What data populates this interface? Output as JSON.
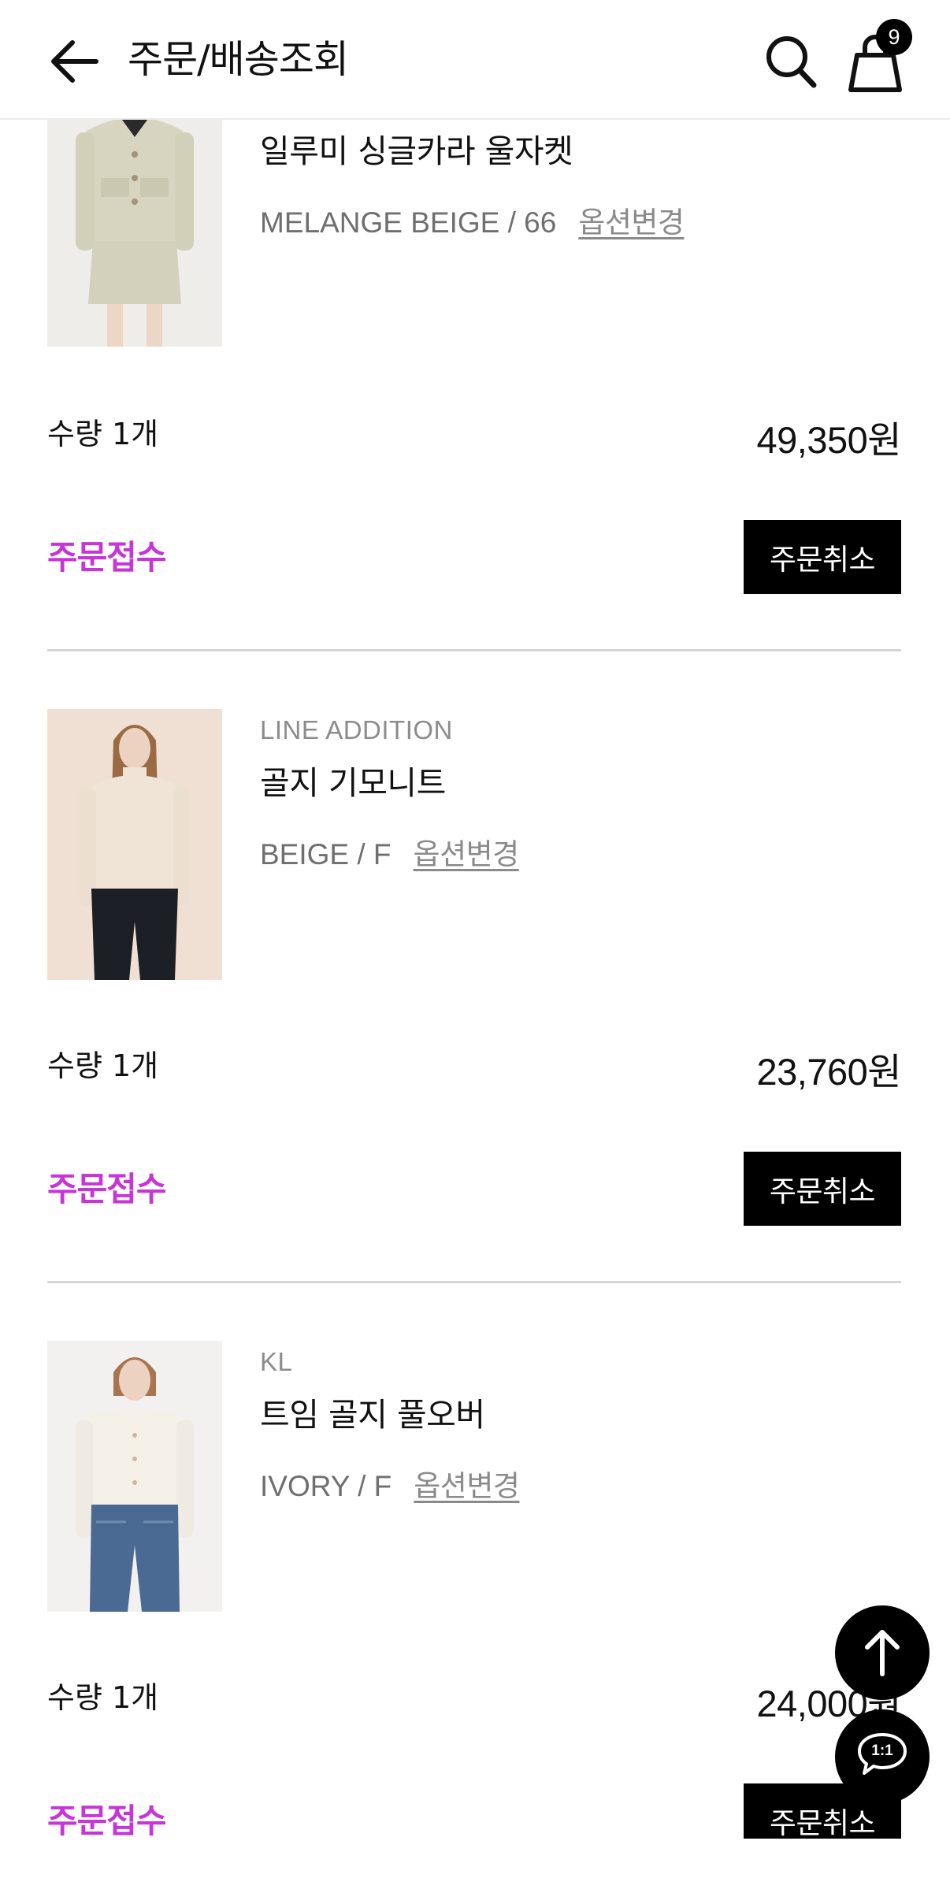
{
  "header": {
    "title": "주문/배송조회",
    "cart_count": "9",
    "icons": {
      "back": "arrow-left-icon",
      "search": "search-icon",
      "cart": "shopping-bag-icon"
    }
  },
  "orders": [
    {
      "brand": "",
      "name": "일루미 싱글카라 울자켓",
      "option": "MELANGE BEIGE / 66",
      "option_change": "옵션변경",
      "quantity": "수량 1개",
      "price_number": "49,350",
      "price_unit": "원",
      "status": "주문접수",
      "cancel_label": "주문취소"
    },
    {
      "brand": "LINE ADDITION",
      "name": "골지 기모니트",
      "option": "BEIGE / F",
      "option_change": "옵션변경",
      "quantity": "수량 1개",
      "price_number": "23,760",
      "price_unit": "원",
      "status": "주문접수",
      "cancel_label": "주문취소"
    },
    {
      "brand": "KL",
      "name": "트임 골지 풀오버",
      "option": "IVORY / F",
      "option_change": "옵션변경",
      "quantity": "수량 1개",
      "price_number": "24,000",
      "price_unit": "원",
      "status": "주문접수",
      "cancel_label": "주문취소"
    }
  ],
  "floating": {
    "scroll_top_icon": "arrow-up-icon",
    "chat_icon": "chat-bubble-icon",
    "chat_label": "1:1"
  },
  "colors": {
    "status": "#c734d8",
    "button_bg": "#000000",
    "divider": "#d6d6d6"
  }
}
